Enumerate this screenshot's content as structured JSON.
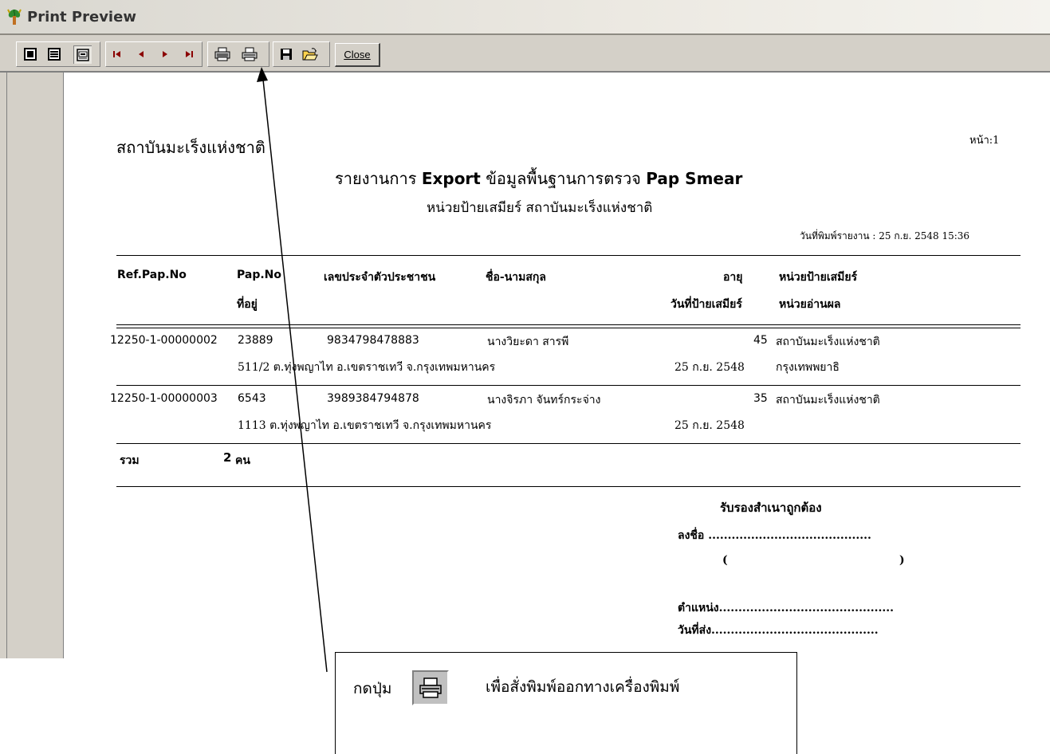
{
  "window": {
    "title": "Print Preview",
    "close_label": "Close"
  },
  "toolbar": {
    "icons": [
      "one-page-view-icon",
      "multi-page-view-icon",
      "zoom-icon",
      "first-page-icon",
      "previous-page-icon",
      "next-page-icon",
      "last-page-icon",
      "print-setup-icon",
      "print-icon",
      "save-icon",
      "open-icon"
    ]
  },
  "report": {
    "org": "สถาบันมะเร็งแห่งชาติ",
    "page": "หน้า:1",
    "title_pre": "รายงานการ",
    "title_export": "Export",
    "title_mid": "ข้อมูลพื้นฐานการตรวจ",
    "title_pap": "Pap Smear",
    "subtitle": "หน่วยป้ายเสมียร์  สถาบันมะเร็งแห่งชาติ",
    "print_date": "วันที่พิมพ์รายงาน : 25 ก.ย. 2548 15:36",
    "headers": {
      "ref": "Ref.Pap.No",
      "pap": "Pap.No",
      "address": "ที่อยู่",
      "citizen_id": "เลขประจำตัวประชาชน",
      "name": "ชื่อ-นามสกุล",
      "age": "อายุ",
      "smear_date": "วันที่ป้ายเสมียร์",
      "smear_unit": "หน่วยป้ายเสมียร์",
      "read_unit": "หน่วยอ่านผล"
    },
    "rows": [
      {
        "ref": "12250-1-00000002",
        "pap": "23889",
        "citizen_id": "9834798478883",
        "name": "นางวิยะดา สารพี",
        "age": "45",
        "smear_unit": "สถาบันมะเร็งแห่งชาติ",
        "address": "511/2 ต.ทุ่งพญาไท อ.เขตราชเทวี จ.กรุงเทพมหานคร",
        "smear_date": "25 ก.ย. 2548",
        "read_unit": "กรุงเทพพยาธิ"
      },
      {
        "ref": "12250-1-00000003",
        "pap": "6543",
        "citizen_id": "3989384794878",
        "name": "นางจิรภา จันทร์กระจ่าง",
        "age": "35",
        "smear_unit": "สถาบันมะเร็งแห่งชาติ",
        "address": "1113 ต.ทุ่งพญาไท อ.เขตราชเทวี จ.กรุงเทพมหานคร",
        "smear_date": "25 ก.ย. 2548",
        "read_unit": ""
      }
    ],
    "total_label": "รวม",
    "total_count": "2",
    "total_unit": "คน",
    "certify": "รับรองสำเนาถูกต้อง",
    "sign_line": "ลงชื่อ ..........................................",
    "paren_open": "(",
    "paren_close": ")",
    "position_line": "ตำแหน่ง.............................................",
    "sent_date_line": "วันที่ส่ง..........................................."
  },
  "callout": {
    "press_label": "กดปุ่ม",
    "description": "เพื่อสั่งพิมพ์ออกทางเครื่องพิมพ์",
    "icon": "print-icon"
  }
}
